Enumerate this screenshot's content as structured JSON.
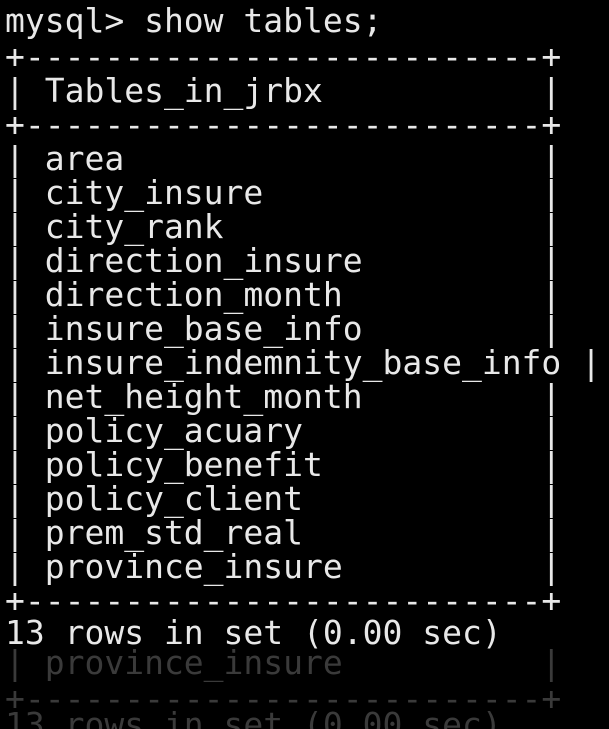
{
  "terminal": {
    "prompt_line": "mysql> show tables;",
    "border_line": "+--------------------------+",
    "header_line": "| Tables_in_jrbx           |",
    "rows": [
      "| area                     |",
      "| city_insure              |",
      "| city_rank                |",
      "| direction_insure         |",
      "| direction_month          |",
      "| insure_base_info         |",
      "| insure_indemnity_base_info |",
      "| net_height_month         |",
      "| policy_acuary            |",
      "| policy_benefit           |",
      "| policy_client            |",
      "| prem_std_real            |",
      "| province_insure          |"
    ],
    "result_line": "13 rows in set (0.00 sec)",
    "ghost_row": "| province_insure          |",
    "ghost_border": "+--------------------------+",
    "ghost_result": "13 rows in set (0.00 sec)",
    "colors": {
      "background": "#000000",
      "text": "#e8e8e8",
      "ghost_text": "#3a3a3a"
    }
  }
}
